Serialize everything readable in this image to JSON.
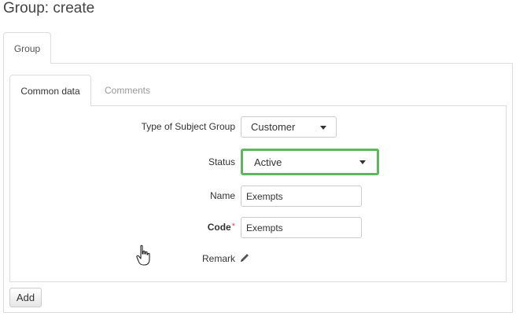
{
  "page": {
    "title": "Group: create"
  },
  "outer_tabs": [
    {
      "label": "Group",
      "active": true
    }
  ],
  "inner_tabs": [
    {
      "label": "Common data",
      "active": true
    },
    {
      "label": "Comments",
      "active": false
    }
  ],
  "form": {
    "subject_group_type": {
      "label": "Type of Subject Group",
      "value": "Customer"
    },
    "status": {
      "label": "Status",
      "value": "Active",
      "focused": true
    },
    "name": {
      "label": "Name",
      "value": "Exempts"
    },
    "code": {
      "label": "Code",
      "required_marker": "*",
      "value": "Exempts"
    },
    "remark": {
      "label": "Remark",
      "icon": "pencil-icon"
    }
  },
  "actions": {
    "add_label": "Add"
  },
  "colors": {
    "focus_border": "#5cb85c",
    "required": "#d9534f",
    "inactive_tab_text": "#999999",
    "border": "#dddddd"
  }
}
